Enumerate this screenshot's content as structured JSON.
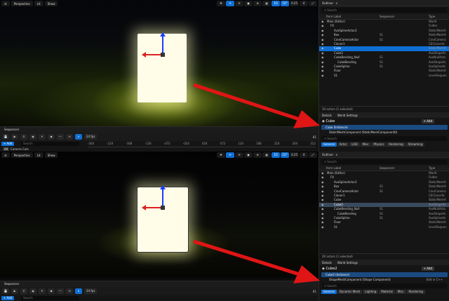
{
  "viewport": {
    "mode_label": "Perspective",
    "lit_label": "Lit",
    "show_label": "Show",
    "snap_values": [
      "10",
      "10°",
      "0.25",
      "4"
    ]
  },
  "sequencer": {
    "tab_label": "Sequencer",
    "fps": "24 fps",
    "frame_top": "81",
    "frame_bottom": "81",
    "add_label": "+ Add",
    "search_placeholder": "Search",
    "ruler_ticks": [
      "-264",
      "-216",
      "-168",
      "-120",
      "-072",
      "-024",
      "024",
      "072",
      "120",
      "168",
      "216",
      "264",
      "312",
      "360",
      "408"
    ],
    "track_label": "Camera Cuts",
    "track_tag": "All"
  },
  "outliner": {
    "tab_label": "Outliner",
    "tab2_label": "Sequencer",
    "search_placeholder": "Search",
    "col_item_label": "Item Label",
    "col_sequencer": "Sequencer",
    "col_type": "Type",
    "top_rows": [
      {
        "label": "Main (Editor)",
        "seq": "",
        "type": "World",
        "indent": 1
      },
      {
        "label": "FX",
        "seq": "",
        "type": "Folder",
        "indent": 2
      },
      {
        "label": "AvaSplineActor2",
        "seq": "",
        "type": "StaticMeshA",
        "indent": 3
      },
      {
        "label": "Box",
        "seq": "S1",
        "type": "StaticMeshA",
        "indent": 3
      },
      {
        "label": "CineCameraActor",
        "seq": "S1",
        "type": "CineCamera",
        "indent": 3
      },
      {
        "label": "Cloner1",
        "seq": "",
        "type": "CEClonerAc",
        "indent": 3
      },
      {
        "label": "Cube",
        "seq": "",
        "type": "StaticMeshA",
        "indent": 3
      },
      {
        "label": "Cube2",
        "seq": "",
        "type": "AvaShapeAc",
        "indent": 3
      },
      {
        "label": "CubeBending_Null",
        "seq": "S1",
        "type": "AvaNullActo",
        "indent": 3
      },
      {
        "label": "CubeBending",
        "seq": "S1",
        "type": "AvaShapeAc",
        "indent": 4
      },
      {
        "label": "CubeSpline",
        "seq": "S1",
        "type": "AvaSplineAc",
        "indent": 3
      },
      {
        "label": "Floor",
        "seq": "",
        "type": "StaticMeshA",
        "indent": 3
      },
      {
        "label": "S1",
        "seq": "",
        "type": "LevelSequen",
        "indent": 3
      }
    ],
    "bot_rows": [
      {
        "label": "Main (Editor)",
        "seq": "",
        "type": "World",
        "indent": 1
      },
      {
        "label": "FX",
        "seq": "",
        "type": "Folder",
        "indent": 2
      },
      {
        "label": "AvaSplineActor2",
        "seq": "",
        "type": "StaticMeshA",
        "indent": 3
      },
      {
        "label": "Box",
        "seq": "S1",
        "type": "StaticMeshA",
        "indent": 3
      },
      {
        "label": "CineCameraActor",
        "seq": "S1",
        "type": "CineCamera",
        "indent": 3
      },
      {
        "label": "Cloner1",
        "seq": "",
        "type": "CEClonerAc",
        "indent": 3
      },
      {
        "label": "Cube",
        "seq": "",
        "type": "StaticMeshA",
        "indent": 3
      },
      {
        "label": "Cube2",
        "seq": "",
        "type": "AvaShapeAc",
        "indent": 3
      },
      {
        "label": "CubeBending_Null",
        "seq": "S1",
        "type": "AvaNullActo",
        "indent": 3
      },
      {
        "label": "CubeBending",
        "seq": "S1",
        "type": "AvaShapeAc",
        "indent": 4
      },
      {
        "label": "CubeSpline",
        "seq": "S1",
        "type": "AvaSplineAc",
        "indent": 3
      },
      {
        "label": "Floor",
        "seq": "",
        "type": "StaticMeshA",
        "indent": 3
      },
      {
        "label": "S1",
        "seq": "",
        "type": "LevelSequen",
        "indent": 3
      }
    ],
    "count_label": "20 actors (1 selected)"
  },
  "details_top": {
    "tab_label": "Details",
    "tab2_label": "World Settings",
    "actor_name": "Cube",
    "add_label": "+ Add",
    "instance_label": "Cube (Instance)",
    "component_label": "StaticMeshComponent (StaticMeshComponent0)",
    "edit_label": "",
    "search_placeholder": "Search",
    "filters": [
      "General",
      "Actor",
      "LOD",
      "Misc",
      "Physics",
      "Rendering",
      "Streaming"
    ]
  },
  "details_bot": {
    "tab_label": "Details",
    "tab2_label": "World Settings",
    "actor_name": "Cube2",
    "add_label": "+ Add",
    "instance_label": "Cube2 (Instance)",
    "component_label": "ShapeMeshComponent (Shape Component)",
    "edit_label": "Edit in C++",
    "search_placeholder": "Search",
    "filters": [
      "General",
      "Dynamic Mesh",
      "Lighting",
      "Material",
      "Misc",
      "Rendering"
    ]
  }
}
